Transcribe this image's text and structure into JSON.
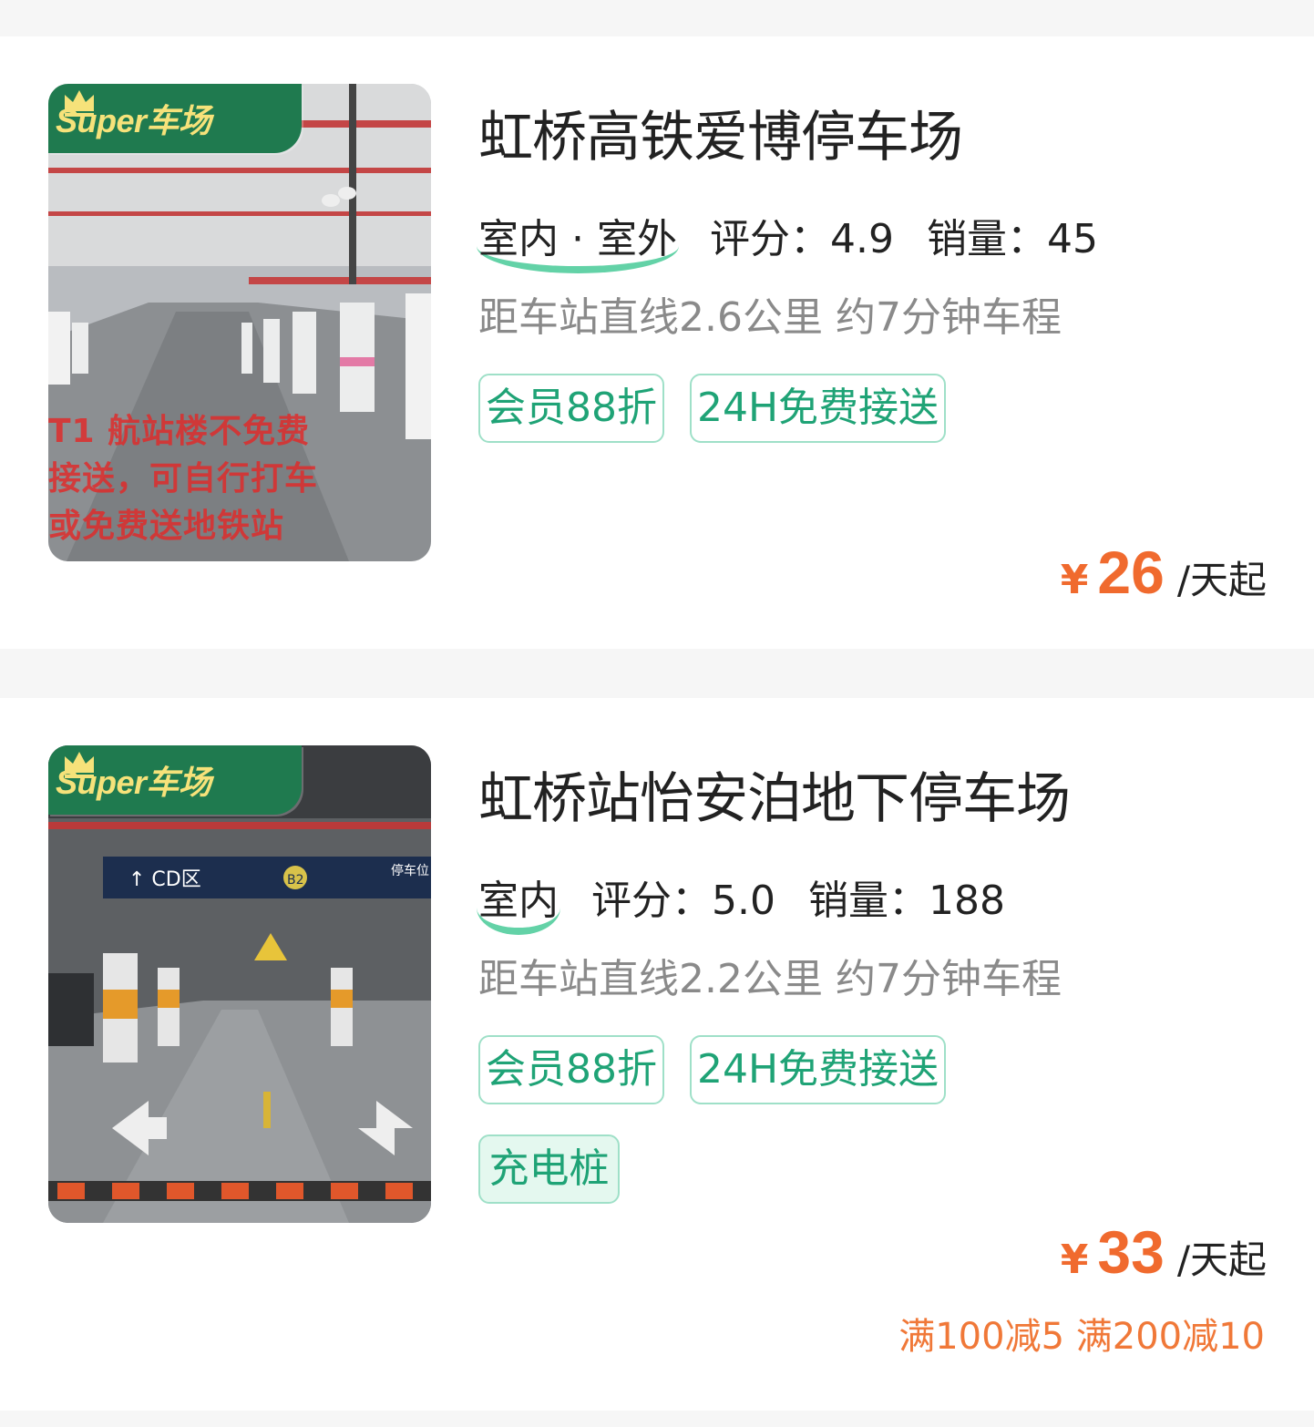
{
  "colors": {
    "page_bg": "#f6f6f6",
    "card_bg": "#ffffff",
    "tag_green": "#1fa376",
    "price_orange": "#f06a2e",
    "badge_green": "#1f7a4f",
    "badge_text": "#f6e27a"
  },
  "listings": [
    {
      "badge": "Super车场",
      "photo_overlay_lines": [
        "T1 航站楼不免费",
        "接送，可自行打车",
        "或免费送地铁站"
      ],
      "title": "虹桥高铁爱博停车场",
      "env": "室内 · 室外",
      "rating_label": "评分：",
      "rating": "4.9",
      "sales_label": "销量：",
      "sales": "45",
      "distance": "距车站直线2.6公里 约7分钟车程",
      "tags": [
        "会员88折",
        "24H免费接送"
      ],
      "currency": "¥",
      "price": "26",
      "unit": "/天起"
    },
    {
      "badge": "Super车场",
      "sign_text": "↑ CD区",
      "sign_level": "B2",
      "sign_right": "停车位",
      "title": "虹桥站怡安泊地下停车场",
      "env": "室内",
      "rating_label": "评分：",
      "rating": "5.0",
      "sales_label": "销量：",
      "sales": "188",
      "distance": "距车站直线2.2公里 约7分钟车程",
      "tags": [
        "会员88折",
        "24H免费接送"
      ],
      "feature_tag": "充电桩",
      "currency": "¥",
      "price": "33",
      "unit": "/天起",
      "promo": "满100减5 满200减10"
    }
  ]
}
